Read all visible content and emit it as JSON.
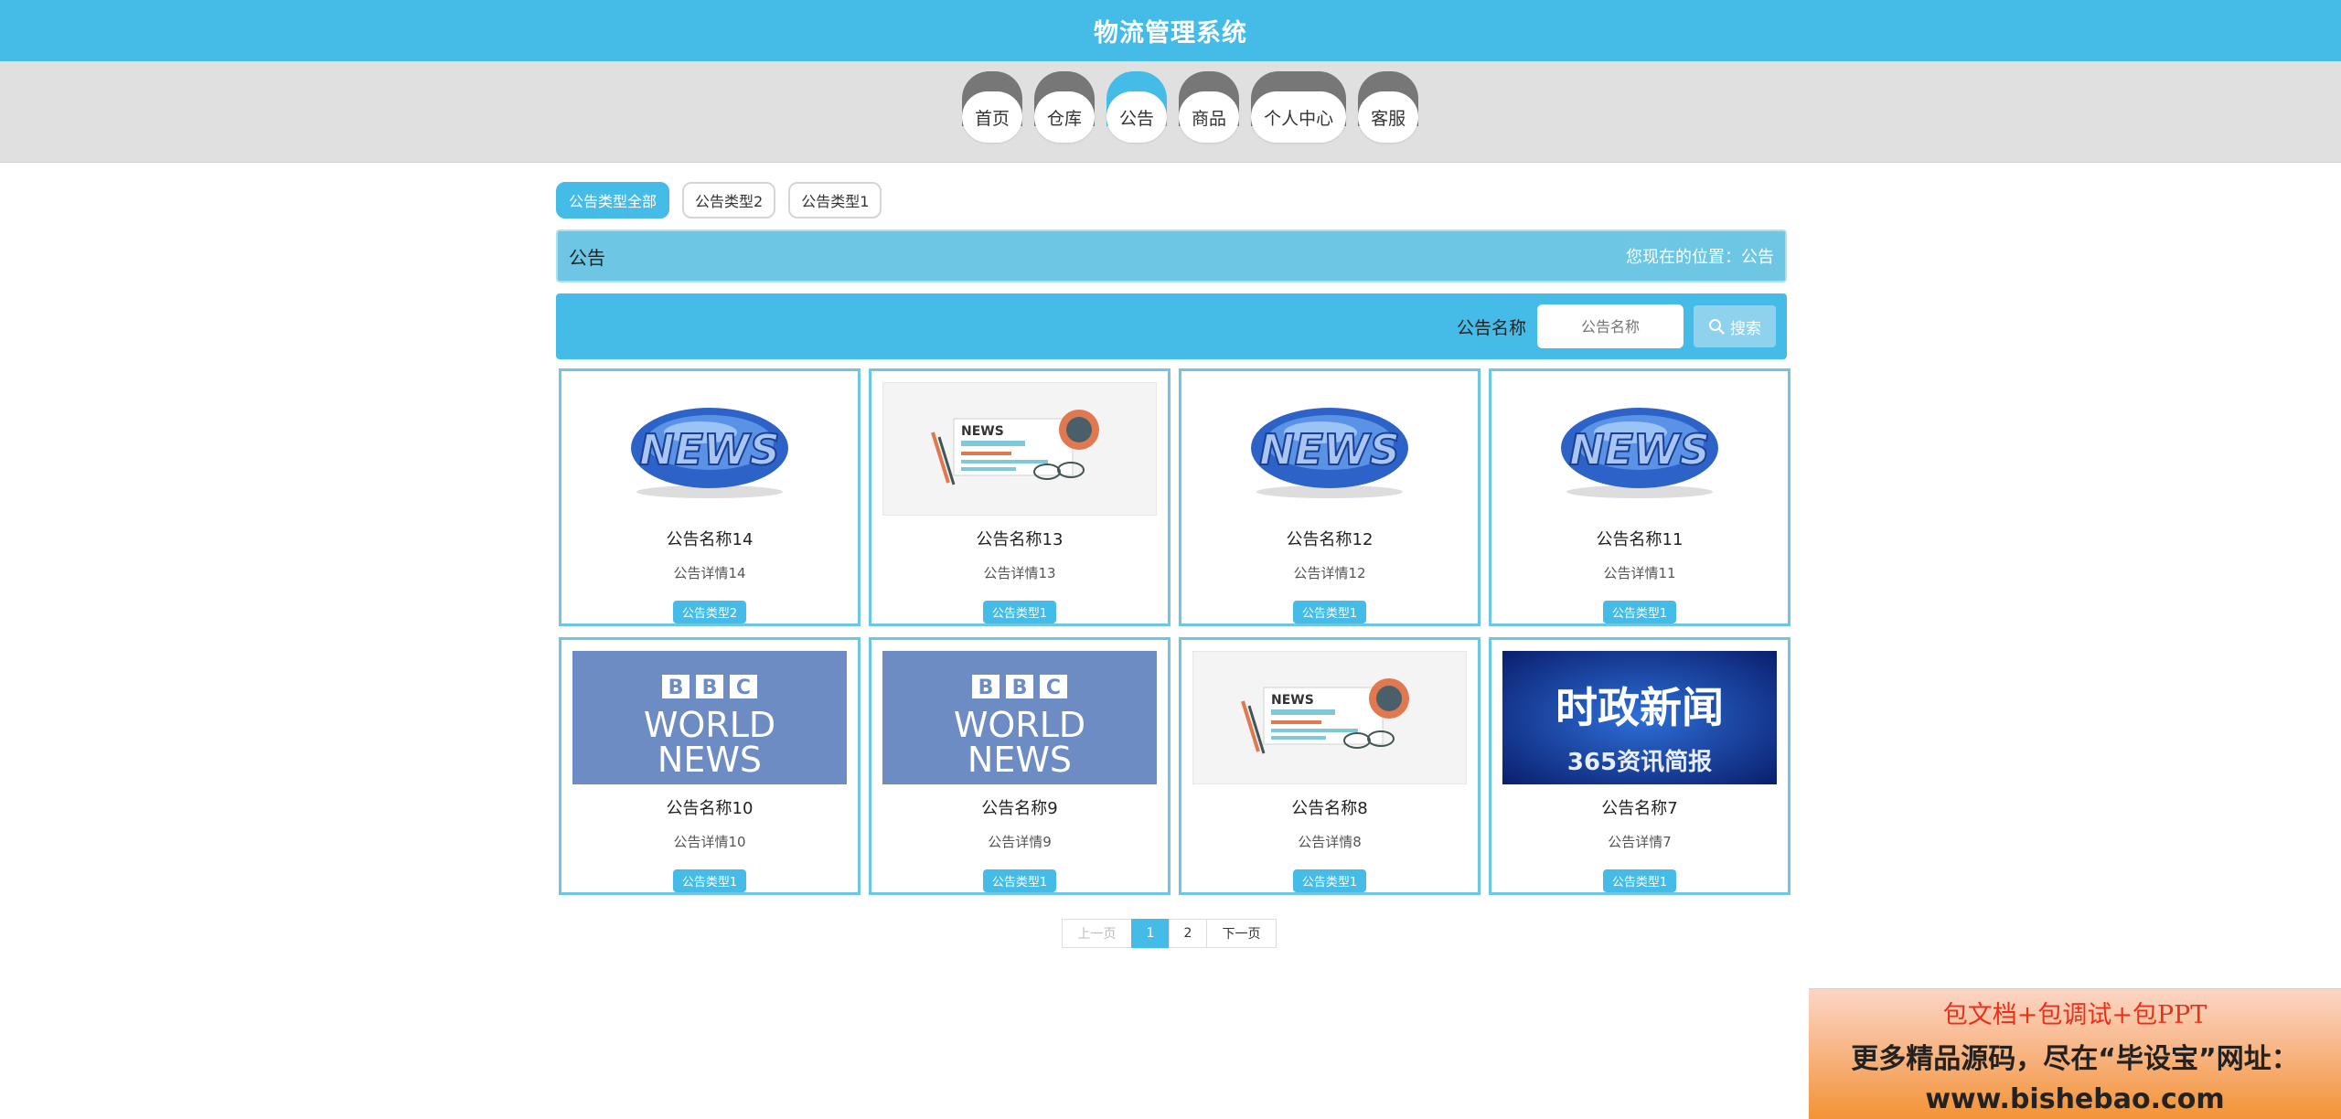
{
  "app": {
    "title": "物流管理系统"
  },
  "nav": {
    "items": [
      {
        "label": "首页"
      },
      {
        "label": "仓库"
      },
      {
        "label": "公告",
        "active": true
      },
      {
        "label": "商品"
      },
      {
        "label": "个人中心"
      },
      {
        "label": "客服"
      }
    ]
  },
  "filters": [
    {
      "label": "公告类型全部",
      "active": true
    },
    {
      "label": "公告类型2"
    },
    {
      "label": "公告类型1"
    }
  ],
  "header": {
    "title": "公告",
    "location": "您现在的位置：公告"
  },
  "search": {
    "label": "公告名称",
    "placeholder": "公告名称",
    "button": "搜索"
  },
  "cards": [
    {
      "title": "公告名称14",
      "detail": "公告详情14",
      "type": "公告类型2",
      "image": "news-globe"
    },
    {
      "title": "公告名称13",
      "detail": "公告详情13",
      "type": "公告类型1",
      "image": "news-paper"
    },
    {
      "title": "公告名称12",
      "detail": "公告详情12",
      "type": "公告类型1",
      "image": "news-globe"
    },
    {
      "title": "公告名称11",
      "detail": "公告详情11",
      "type": "公告类型1",
      "image": "news-globe"
    },
    {
      "title": "公告名称10",
      "detail": "公告详情10",
      "type": "公告类型1",
      "image": "bbc-world-news"
    },
    {
      "title": "公告名称9",
      "detail": "公告详情9",
      "type": "公告类型1",
      "image": "bbc-world-news"
    },
    {
      "title": "公告名称8",
      "detail": "公告详情8",
      "type": "公告类型1",
      "image": "news-paper"
    },
    {
      "title": "公告名称7",
      "detail": "公告详情7",
      "type": "公告类型1",
      "image": "politics-news"
    }
  ],
  "images": {
    "news_text": "NEWS",
    "bbc_letters": [
      "B",
      "B",
      "C"
    ],
    "bbc_line1": "WORLD",
    "bbc_line2": "NEWS",
    "politics_line1": "时政新闻",
    "politics_line2": "365资讯简报"
  },
  "pagination": {
    "prev": "上一页",
    "pages": [
      "1",
      "2"
    ],
    "current": "1",
    "next": "下一页"
  },
  "promo": {
    "line1": "包文档+包调试+包PPT",
    "line2": "更多精品源码，尽在“毕设宝”网址：",
    "line3": "www.bishebao.com"
  },
  "colors": {
    "primary": "#45bbe7",
    "header_bar": "#6cc6e4",
    "nav_cap": "#777777"
  },
  "icons": {
    "search_button": "search-icon"
  }
}
